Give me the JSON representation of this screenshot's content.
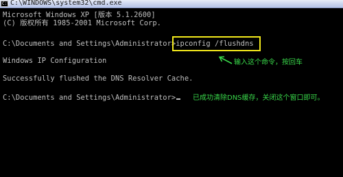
{
  "window": {
    "title": "C:\\WINDOWS\\system32\\cmd.exe",
    "icon_text": "C:\\"
  },
  "console": {
    "lines": [
      "Microsoft Windows XP [版本 5.1.2600]",
      "(C) 版权所有 1985-2001 Microsoft Corp.",
      "",
      "C:\\Documents and Settings\\Administrator>ipconfig /flushdns",
      "",
      "Windows IP Configuration",
      "",
      "Successfully flushed the DNS Resolver Cache.",
      "",
      "C:\\Documents and Settings\\Administrator>"
    ],
    "highlighted_command": "ipconfig /flushdns"
  },
  "annotations": {
    "enter_command": "输入这个命令，按回车",
    "success_note": "已成功清除DNS缓存，关闭这个窗口即可。"
  },
  "colors": {
    "background": "#000000",
    "text": "#c0c0c0",
    "highlight_box": "#f4ea1c",
    "annotation": "#39d84a"
  }
}
